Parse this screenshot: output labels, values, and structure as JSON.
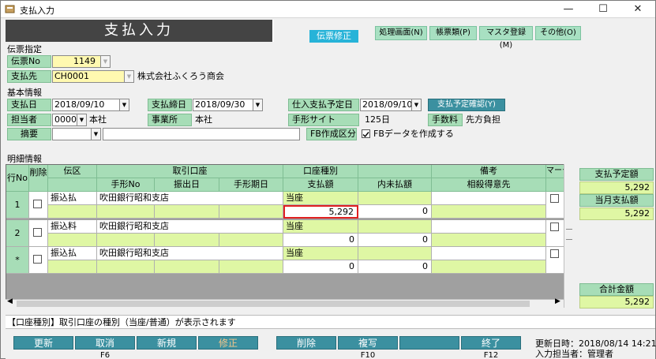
{
  "window": {
    "title": "支払入力",
    "controls": {
      "minimize": "—",
      "maximize": "☐",
      "close": "✕"
    }
  },
  "header": {
    "title": "支払入力",
    "mode": "伝票修正",
    "menus": [
      "処理画面(N)",
      "帳票類(P)",
      "マスタ登録(M)",
      "その他(O)"
    ]
  },
  "voucher_section": {
    "label": "伝票指定",
    "voucher_no_label": "伝票No",
    "voucher_no": "1149",
    "payee_label": "支払先",
    "payee_code": "CH0001",
    "payee_name": "株式会社ふくろう商会"
  },
  "basic_section": {
    "label": "基本情報",
    "pay_date_label": "支払日",
    "pay_date": "2018/09/10",
    "cutoff_label": "支払締日",
    "cutoff_date": "2018/09/30",
    "planned_label": "仕入支払予定日",
    "planned_date": "2018/09/10",
    "planned_button": "支払予定確認(Y)",
    "staff_label": "担当者",
    "staff_code": "0000",
    "staff_name": "本社",
    "office_label": "事業所",
    "office_name": "本社",
    "bill_site_label": "手形サイト",
    "bill_site": "125日",
    "fee_label": "手数料",
    "fee_value": "先方負担",
    "memo_label": "摘要",
    "memo_code": "",
    "memo_text": "",
    "fb_label": "FB作成区分",
    "fb_checkbox_label": "FBデータを作成する",
    "fb_checked": true
  },
  "detail_section": {
    "label": "明細情報",
    "headers_top": [
      "行No",
      "削除",
      "伝区",
      "取引口座",
      "口座種別",
      "",
      "備考",
      "マーク"
    ],
    "headers_bottom": [
      "手形No",
      "振出日",
      "手形期日",
      "支払額",
      "内未払額",
      "相殺得意先"
    ],
    "rows": [
      {
        "no": "1",
        "kind": "振込払",
        "account": "吹田銀行昭和支店",
        "acct_type": "当座",
        "amount": "5,292",
        "unpaid": "0"
      },
      {
        "no": "2",
        "kind": "振込料",
        "account": "吹田銀行昭和支店",
        "acct_type": "当座",
        "amount": "0",
        "unpaid": "0"
      },
      {
        "no": "*",
        "kind": "振込払",
        "account": "吹田銀行昭和支店",
        "acct_type": "当座",
        "amount": "0",
        "unpaid": "0"
      }
    ]
  },
  "summary": {
    "planned_label": "支払予定額",
    "planned_value": "5,292",
    "month_label": "当月支払額",
    "month_value": "5,292",
    "total_label": "合計金額",
    "total_value": "5,292"
  },
  "status_message": "【口座種別】取引口座の種別（当座/普通）が表示されます",
  "function_keys": [
    {
      "label": "更新",
      "sub": ""
    },
    {
      "label": "取消",
      "sub": "F6"
    },
    {
      "label": "新規",
      "sub": ""
    },
    {
      "label": "修正",
      "sub": ""
    },
    {
      "label": "削除",
      "sub": ""
    },
    {
      "label": "複写",
      "sub": "F10"
    },
    {
      "label": "",
      "sub": ""
    },
    {
      "label": "終了",
      "sub": "F12"
    }
  ],
  "update_info": {
    "updated": "更新日時：2018/08/14 14:21",
    "operator": "入力担当者：管理者"
  },
  "colors": {
    "header_dark": "#444444",
    "label_green": "#a7ddb7",
    "input_green": "#dff7a4",
    "accent_blue": "#27b3d8",
    "fkey_teal": "#3b90a0",
    "highlight_red": "#e02020"
  }
}
